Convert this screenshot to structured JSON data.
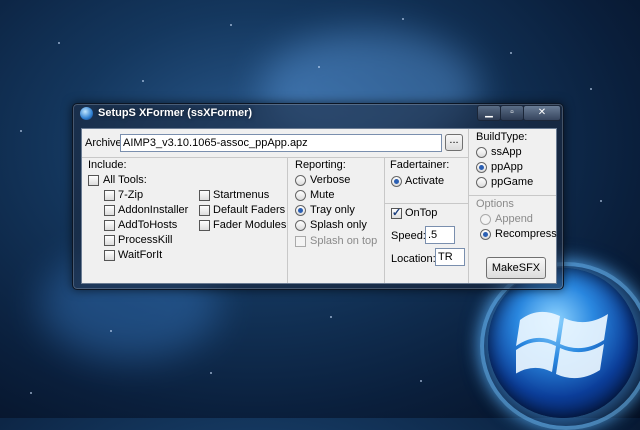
{
  "window": {
    "title": "SetupS XFormer (ssXFormer)",
    "minimize": "▁",
    "maximize": "▫",
    "close": "✕"
  },
  "archive": {
    "label": "Archive:",
    "value": "AIMP3_v3.10.1065-assoc_ppApp.apz",
    "browse_label": "..."
  },
  "include": {
    "label": "Include:",
    "all_tools": {
      "label": "All Tools:",
      "checked": false
    },
    "tools_col1": [
      {
        "label": "7-Zip",
        "checked": false
      },
      {
        "label": "AddonInstaller",
        "checked": false
      },
      {
        "label": "AddToHosts",
        "checked": false
      },
      {
        "label": "ProcessKill",
        "checked": false
      },
      {
        "label": "WaitForIt",
        "checked": false
      }
    ],
    "tools_col2": [
      {
        "label": "Startmenus",
        "checked": false
      },
      {
        "label": "Default Faders",
        "checked": false
      },
      {
        "label": "Fader Modules",
        "checked": false
      }
    ]
  },
  "reporting": {
    "label": "Reporting:",
    "options": [
      {
        "label": "Verbose",
        "checked": false
      },
      {
        "label": "Mute",
        "checked": false
      },
      {
        "label": "Tray only",
        "checked": true
      },
      {
        "label": "Splash only",
        "checked": false
      }
    ],
    "splash_on_top": {
      "label": "Splash on top",
      "checked": false,
      "disabled": true
    }
  },
  "fadertainer": {
    "label": "Fadertainer:",
    "activate": {
      "label": "Activate",
      "checked": true
    },
    "ontop": {
      "label": "OnTop",
      "checked": true
    },
    "speed_label": "Speed:",
    "speed_value": ".5",
    "location_label": "Location:",
    "location_value": "TR"
  },
  "buildtype": {
    "label": "BuildType:",
    "options": [
      {
        "label": "ssApp",
        "checked": false
      },
      {
        "label": "ppApp",
        "checked": true
      },
      {
        "label": "ppGame",
        "checked": false
      }
    ]
  },
  "options": {
    "label": "Options",
    "items": [
      {
        "label": "Append",
        "checked": false,
        "disabled": true
      },
      {
        "label": "Recompress",
        "checked": true,
        "disabled": false
      }
    ]
  },
  "make_button": "MakeSFX"
}
